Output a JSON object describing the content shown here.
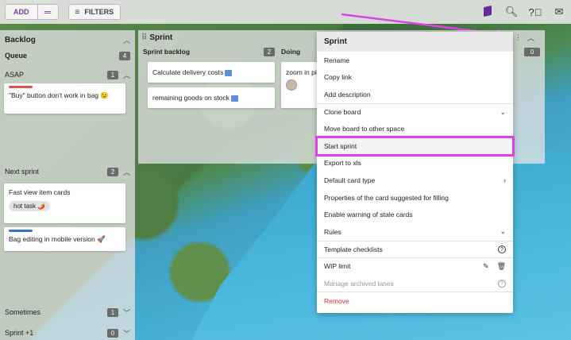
{
  "toolbar": {
    "add_label": "ADD",
    "filters_label": "FILTERS",
    "icons": [
      "book-icon",
      "search-icon",
      "help-icon",
      "mail-icon"
    ]
  },
  "backlog": {
    "title": "Backlog",
    "lanes": [
      {
        "title": "Queue",
        "count": "4"
      },
      {
        "title": "ASAP",
        "count": "1",
        "cards": [
          {
            "text": "\"Buy\" button don't work in bag 😉",
            "stripe": "#e05050"
          }
        ]
      },
      {
        "title": "Next sprint",
        "count": "2",
        "cards": [
          {
            "text": "Fast view item cards",
            "tag": "hot task 🌶️"
          },
          {
            "text": "Bag editing in mobile version 🚀",
            "stripe": "#3b6fd1"
          }
        ]
      },
      {
        "title": "Sometimes",
        "count": "1"
      },
      {
        "title": "Sprint +1",
        "count": "0"
      }
    ]
  },
  "sprint": {
    "title": "Sprint",
    "columns": [
      {
        "title": "Sprint backlog",
        "count": "2",
        "cards": [
          "Calculate delivery costs",
          "remaining goods on stock"
        ]
      },
      {
        "title": "Doing",
        "cards": [
          "zoom in pi it"
        ]
      },
      {
        "title": "",
        "count": "0"
      }
    ]
  },
  "menu": {
    "title": "Sprint",
    "items": [
      {
        "label": "Rename"
      },
      {
        "label": "Copy link"
      },
      {
        "label": "Add description"
      },
      {
        "label": "Clone board",
        "icon": "chevron-down-icon",
        "sep": true
      },
      {
        "label": "Move board to other space"
      },
      {
        "label": "Start sprint",
        "highlight": true
      },
      {
        "label": "Export to xls"
      },
      {
        "label": "Default card type",
        "icon": "chevron-right-icon"
      },
      {
        "label": "Properties of the card suggested for filling"
      },
      {
        "label": "Enable warning of stale cards"
      },
      {
        "label": "Rules",
        "icon": "chevron-down-icon"
      },
      {
        "label": "Template checklists",
        "icon": "help-icon",
        "sep": true
      },
      {
        "label": "WIP limit",
        "icon": "edit-delete-icons",
        "sep": true
      },
      {
        "label": "Manage archived lanes",
        "icon": "help-icon",
        "dim": true
      },
      {
        "label": "Remove",
        "danger": true,
        "sep": true
      }
    ]
  }
}
